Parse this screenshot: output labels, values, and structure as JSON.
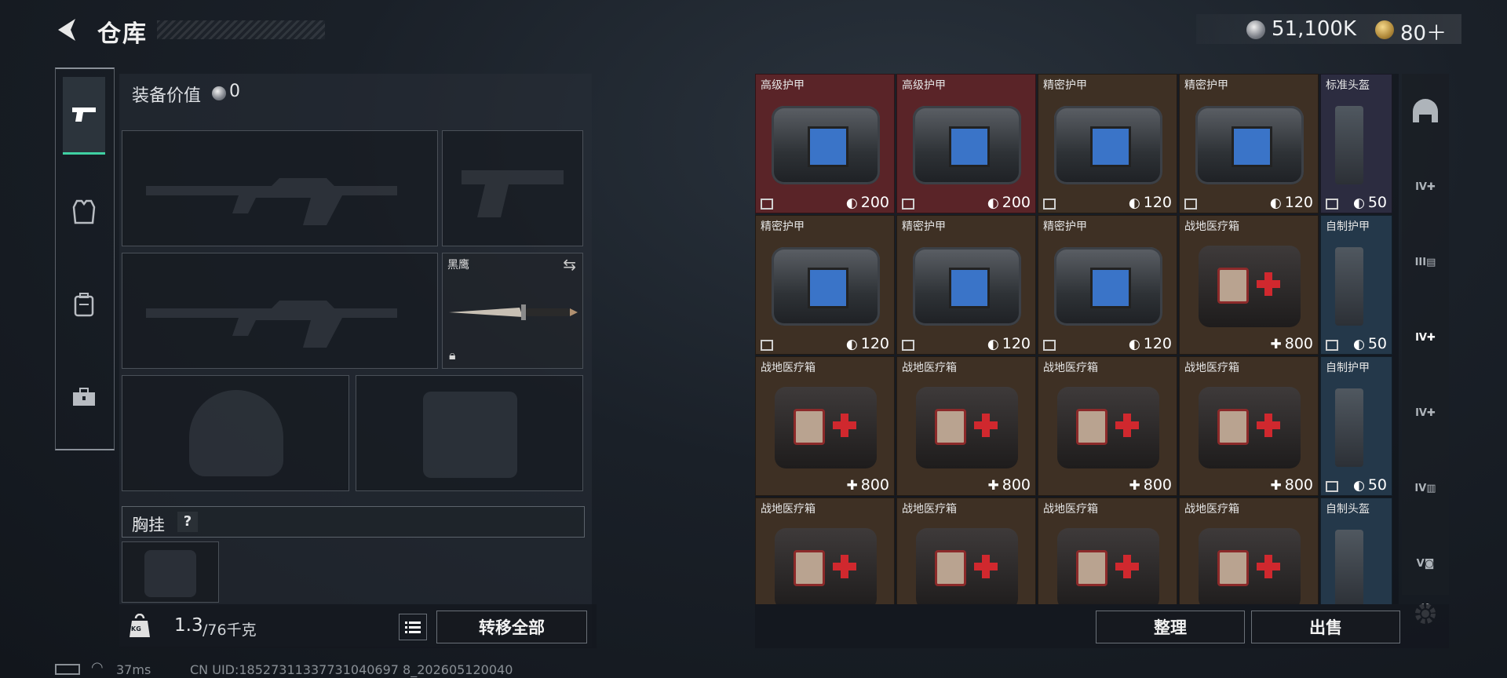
{
  "header": {
    "title": "仓库",
    "silver": "51,100K",
    "gold": "80＋"
  },
  "tabs": [
    {
      "name": "weapons",
      "icon": "pistol-icon",
      "active": true
    },
    {
      "name": "armor",
      "icon": "armor-vest-icon",
      "active": false
    },
    {
      "name": "backpack",
      "icon": "backpack-icon",
      "active": false
    },
    {
      "name": "case",
      "icon": "toolbox-icon",
      "active": false
    }
  ],
  "equipment": {
    "label": "装备价值",
    "value": "0",
    "melee_name": "黑鹰",
    "chest_rig_label": "胸挂",
    "chest_help": "?",
    "weight_current": "1.3",
    "weight_max": "/76千克",
    "kg_label": "KG",
    "transfer_all": "转移全部"
  },
  "inventory": {
    "cells": [
      {
        "name": "高级护甲",
        "value": "200",
        "type": "bag",
        "bg": "#5a2428"
      },
      {
        "name": "高级护甲",
        "value": "200",
        "type": "bag",
        "bg": "#5a2428"
      },
      {
        "name": "精密护甲",
        "value": "120",
        "type": "bag",
        "bg": "#3e3024"
      },
      {
        "name": "精密护甲",
        "value": "120",
        "type": "bag",
        "bg": "#3e3024"
      },
      {
        "name": "标准头盔",
        "value": "50",
        "type": "vest",
        "bg": "#2c2c40"
      },
      {
        "name": "精密护甲",
        "value": "120",
        "type": "bag",
        "bg": "#3e3024"
      },
      {
        "name": "精密护甲",
        "value": "120",
        "type": "bag",
        "bg": "#3e3024"
      },
      {
        "name": "精密护甲",
        "value": "120",
        "type": "bag",
        "bg": "#3e3024"
      },
      {
        "name": "战地医疗箱",
        "value": "800",
        "type": "medkit",
        "bg": "#3e3024"
      },
      {
        "name": "自制护甲",
        "value": "50",
        "type": "vest",
        "bg": "#24384a"
      },
      {
        "name": "战地医疗箱",
        "value": "800",
        "type": "medkit",
        "bg": "#3e3024"
      },
      {
        "name": "战地医疗箱",
        "value": "800",
        "type": "medkit",
        "bg": "#3e3024"
      },
      {
        "name": "战地医疗箱",
        "value": "800",
        "type": "medkit",
        "bg": "#3e3024"
      },
      {
        "name": "战地医疗箱",
        "value": "800",
        "type": "medkit",
        "bg": "#3e3024"
      },
      {
        "name": "自制护甲",
        "value": "50",
        "type": "vest",
        "bg": "#24384a"
      },
      {
        "name": "战地医疗箱",
        "value": "",
        "type": "medkit",
        "bg": "#3e3024"
      },
      {
        "name": "战地医疗箱",
        "value": "",
        "type": "medkit",
        "bg": "#3e3024"
      },
      {
        "name": "战地医疗箱",
        "value": "",
        "type": "medkit",
        "bg": "#3e3024"
      },
      {
        "name": "战地医疗箱",
        "value": "",
        "type": "medkit",
        "bg": "#3e3024"
      },
      {
        "name": "自制头盔",
        "value": "",
        "type": "vest",
        "bg": "#24384a"
      }
    ]
  },
  "filters": [
    "helmet-icon",
    "IV",
    "III",
    "IV",
    "IV",
    "IV",
    "V",
    "gear-icon"
  ],
  "actions": {
    "sort": "整理",
    "sell": "出售"
  },
  "status": {
    "ping": "37ms",
    "uid": "CN UID:18527311337731040697 8_202605120040"
  }
}
